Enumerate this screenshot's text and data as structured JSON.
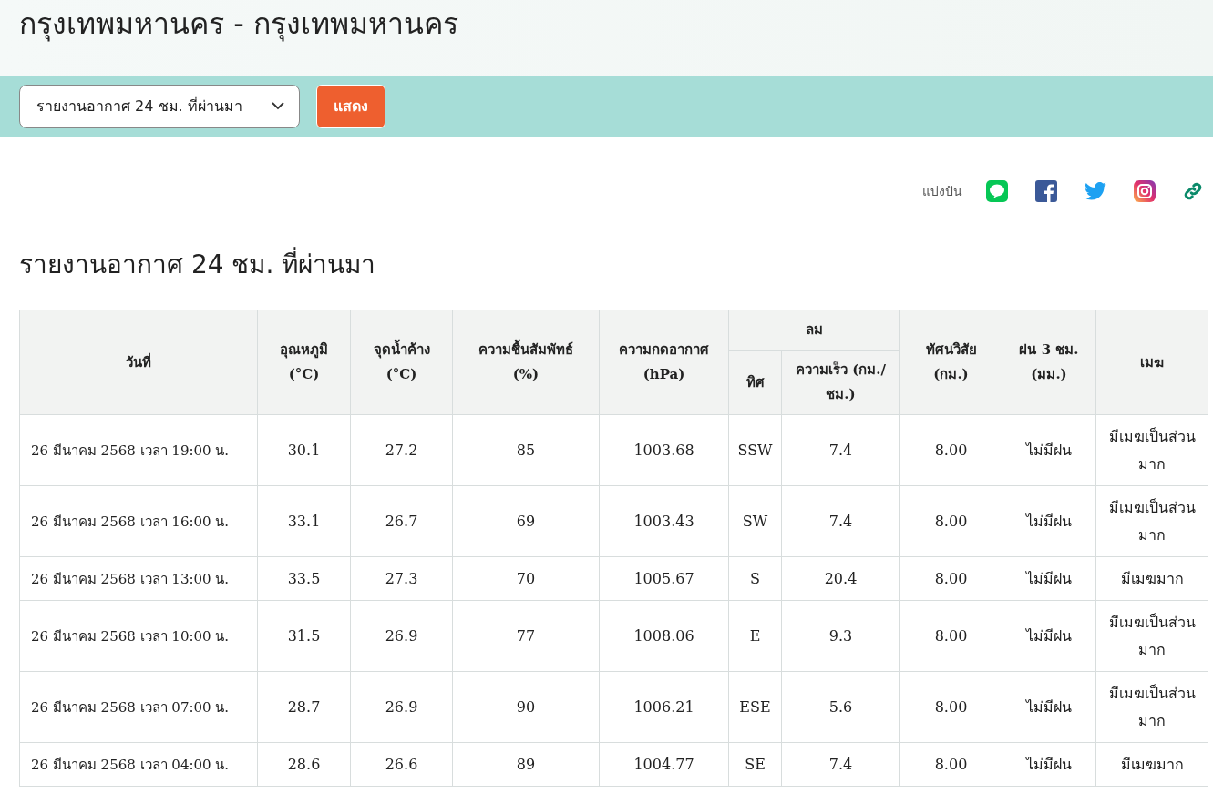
{
  "title": "กรุงเทพมหานคร - กรุงเทพมหานคร",
  "report_select": {
    "value": "รายงานอากาศ 24 ชม. ที่ผ่านมา"
  },
  "show_button": "แสดง",
  "share": {
    "label": "แบ่งปัน"
  },
  "section_title": "รายงานอากาศ 24 ชม. ที่ผ่านมา",
  "table": {
    "header_rows": [
      [
        {
          "label": "วันที่",
          "rowspan": 2
        },
        {
          "label": "อุณหภูมิ\n(°C)",
          "rowspan": 2
        },
        {
          "label": "จุดน้ำค้าง\n(°C)",
          "rowspan": 2
        },
        {
          "label": "ความชื้นสัมพัทธ์\n(%)",
          "rowspan": 2
        },
        {
          "label": "ความกดอากาศ\n(hPa)",
          "rowspan": 2
        },
        {
          "label": "ลม",
          "colspan": 2
        },
        {
          "label": "ทัศนวิสัย\n(กม.)",
          "rowspan": 2
        },
        {
          "label": "ฝน 3 ชม.\n(มม.)",
          "rowspan": 2
        },
        {
          "label": "เมฆ",
          "rowspan": 2
        }
      ],
      [
        {
          "label": "ทิศ"
        },
        {
          "label": "ความเร็ว (กม./\nชม.)"
        }
      ]
    ],
    "rows": [
      [
        "26 มีนาคม 2568 เวลา 19:00 น.",
        "30.1",
        "27.2",
        "85",
        "1003.68",
        "SSW",
        "7.4",
        "8.00",
        "ไม่มีฝน",
        "มีเมฆเป็นส่วนมาก"
      ],
      [
        "26 มีนาคม 2568 เวลา 16:00 น.",
        "33.1",
        "26.7",
        "69",
        "1003.43",
        "SW",
        "7.4",
        "8.00",
        "ไม่มีฝน",
        "มีเมฆเป็นส่วนมาก"
      ],
      [
        "26 มีนาคม 2568 เวลา 13:00 น.",
        "33.5",
        "27.3",
        "70",
        "1005.67",
        "S",
        "20.4",
        "8.00",
        "ไม่มีฝน",
        "มีเมฆมาก"
      ],
      [
        "26 มีนาคม 2568 เวลา 10:00 น.",
        "31.5",
        "26.9",
        "77",
        "1008.06",
        "E",
        "9.3",
        "8.00",
        "ไม่มีฝน",
        "มีเมฆเป็นส่วนมาก"
      ],
      [
        "26 มีนาคม 2568 เวลา 07:00 น.",
        "28.7",
        "26.9",
        "90",
        "1006.21",
        "ESE",
        "5.6",
        "8.00",
        "ไม่มีฝน",
        "มีเมฆเป็นส่วนมาก"
      ],
      [
        "26 มีนาคม 2568 เวลา 04:00 น.",
        "28.6",
        "26.6",
        "89",
        "1004.77",
        "SE",
        "7.4",
        "8.00",
        "ไม่มีฝน",
        "มีเมฆมาก"
      ]
    ]
  }
}
